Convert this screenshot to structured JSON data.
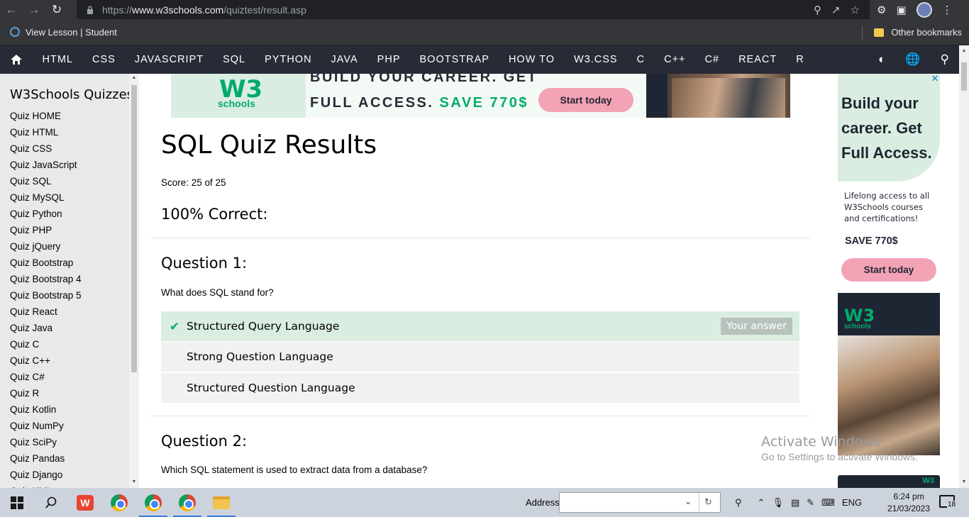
{
  "browser": {
    "url_prefix": "https://",
    "url_host": "www.w3schools.com",
    "url_path": "/quiztest/result.asp",
    "bookmark": "View Lesson | Student",
    "other_bookmarks": "Other bookmarks"
  },
  "nav": {
    "items": [
      "HTML",
      "CSS",
      "JAVASCRIPT",
      "SQL",
      "PYTHON",
      "JAVA",
      "PHP",
      "BOOTSTRAP",
      "HOW TO",
      "W3.CSS",
      "C",
      "C++",
      "C#",
      "REACT",
      "R"
    ]
  },
  "sidebar": {
    "title": "W3Schools Quizzes",
    "links": [
      "Quiz HOME",
      "Quiz HTML",
      "Quiz CSS",
      "Quiz JavaScript",
      "Quiz SQL",
      "Quiz MySQL",
      "Quiz Python",
      "Quiz PHP",
      "Quiz jQuery",
      "Quiz Bootstrap",
      "Quiz Bootstrap 4",
      "Quiz Bootstrap 5",
      "Quiz React",
      "Quiz Java",
      "Quiz C",
      "Quiz C++",
      "Quiz C#",
      "Quiz R",
      "Quiz Kotlin",
      "Quiz NumPy",
      "Quiz SciPy",
      "Quiz Pandas",
      "Quiz Django",
      "Quiz XML"
    ]
  },
  "banner": {
    "logo": "W3",
    "schools": "schools",
    "line1": "BUILD YOUR CAREER. GET",
    "line2_prefix": "FULL ACCESS.",
    "line2_highlight": "SAVE 770$",
    "cta": "Start today"
  },
  "main": {
    "title": "SQL Quiz Results",
    "score": "Score: 25 of 25",
    "percent": "100% Correct:",
    "question1": {
      "heading": "Question 1:",
      "text": "What does SQL stand for?",
      "answers": [
        "Structured Query Language",
        "Strong Question Language",
        "Structured Question Language"
      ],
      "your_answer_label": "Your answer"
    },
    "question2": {
      "heading": "Question 2:",
      "text": "Which SQL statement is used to extract data from a database?"
    }
  },
  "right_ad": {
    "headline": [
      "Build your",
      "career. Get",
      "Full Access."
    ],
    "sub": [
      "Lifelong access to all",
      "W3Schools courses",
      "and certifications!"
    ],
    "save": "SAVE 770$",
    "cta": "Start today",
    "logo": "W3",
    "schools": "schools"
  },
  "watermark": {
    "line1": "Activate Windows",
    "line2": "Go to Settings to activate Windows."
  },
  "taskbar": {
    "address_label": "Address",
    "lang": "ENG",
    "time": "6:24 pm",
    "date": "21/03/2023",
    "notifications": "18"
  },
  "colors": {
    "w3_green": "#04aa6d",
    "nav_bg": "#282a35",
    "correct_bg": "#d9eee1"
  }
}
